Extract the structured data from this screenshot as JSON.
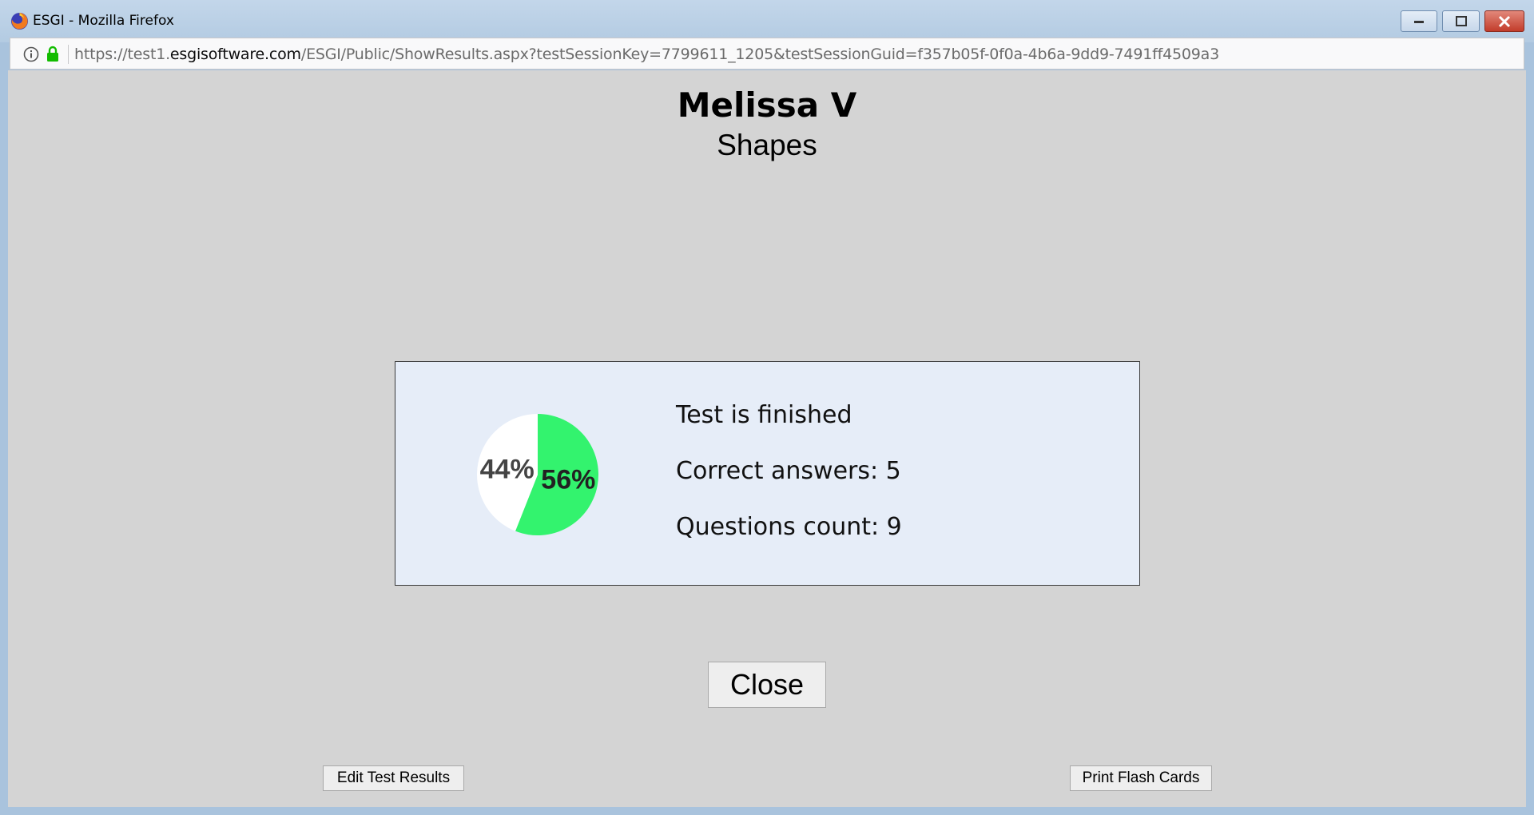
{
  "window": {
    "title": "ESGI - Mozilla Firefox",
    "icon": "firefox-icon"
  },
  "urlbar": {
    "prefix": "https://test1.",
    "domain": "esgisoftware.com",
    "path": "/ESGI/Public/ShowResults.aspx?testSessionKey=7799611_1205&testSessionGuid=f357b05f-0f0a-4b6a-9dd9-7491ff4509a3"
  },
  "header": {
    "student_name": "Melissa V",
    "test_name": "Shapes"
  },
  "result": {
    "status_text": "Test is finished",
    "correct_answers_text": "Correct answers: 5",
    "questions_count_text": "Questions count: 9"
  },
  "chart_data": {
    "type": "pie",
    "slices": [
      {
        "label": "56%",
        "value": 56,
        "color": "#33f36e"
      },
      {
        "label": "44%",
        "value": 44,
        "color": "#ffffff"
      }
    ]
  },
  "buttons": {
    "close_label": "Close",
    "edit_label": "Edit Test Results",
    "print_label": "Print Flash Cards"
  },
  "colors": {
    "correct": "#33f36e",
    "incorrect": "#ffffff",
    "panel_bg": "#e6edf8",
    "page_bg": "#d4d4d4"
  }
}
